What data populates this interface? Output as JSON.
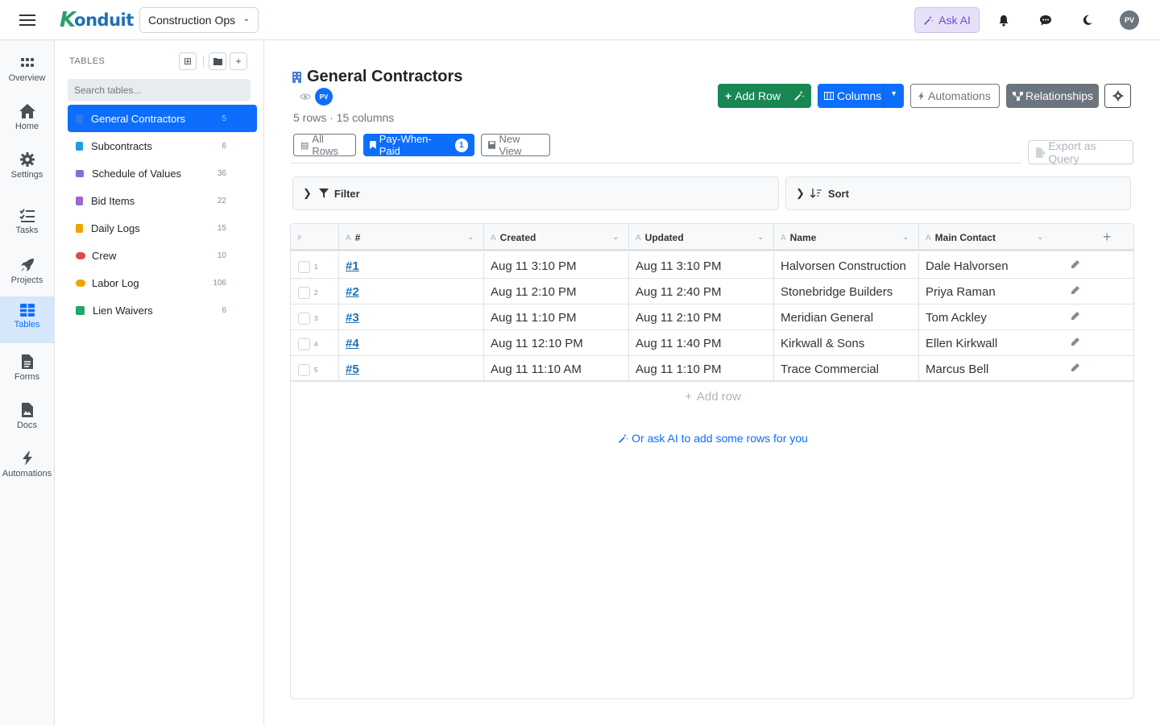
{
  "app": {
    "brand_k": "K",
    "brand_rest": "onduit",
    "workspace": "Construction Ops",
    "ask_ai": "Ask AI",
    "user_initials": "PV"
  },
  "rail": [
    {
      "label": "Overview",
      "icon": "grid-dots-icon"
    },
    {
      "label": "Home",
      "icon": "home-icon"
    },
    {
      "label": "Settings",
      "icon": "gear-icon"
    },
    {
      "label": "Tasks",
      "icon": "tasks-icon"
    },
    {
      "label": "Projects",
      "icon": "rocket-icon"
    },
    {
      "label": "Tables",
      "icon": "table-icon"
    },
    {
      "label": "Forms",
      "icon": "form-icon"
    },
    {
      "label": "Docs",
      "icon": "doc-icon"
    },
    {
      "label": "Automations",
      "icon": "bolt-icon"
    }
  ],
  "tables_panel": {
    "label": "TABLES",
    "search_placeholder": "Search tables...",
    "items": [
      {
        "name": "General Contractors",
        "count": "5",
        "color": "#4a7fd8"
      },
      {
        "name": "Subcontracts",
        "count": "6",
        "color": "#1a9fe0"
      },
      {
        "name": "Schedule of Values",
        "count": "36",
        "color": "#8a6cd6"
      },
      {
        "name": "Bid Items",
        "count": "22",
        "color": "#a066d4"
      },
      {
        "name": "Daily Logs",
        "count": "15",
        "color": "#f0a400"
      },
      {
        "name": "Crew",
        "count": "10",
        "color": "#e04848"
      },
      {
        "name": "Labor Log",
        "count": "106",
        "color": "#f0a400"
      },
      {
        "name": "Lien Waivers",
        "count": "6",
        "color": "#1fa86a"
      }
    ]
  },
  "page": {
    "title": "General Contractors",
    "owner_initials": "PV",
    "subtitle": "5 rows · 15 columns",
    "buttons": {
      "add_row": "Add Row",
      "columns": "Columns",
      "automations": "Automations",
      "relationships": "Relationships",
      "export": "Export as Query"
    },
    "views": [
      {
        "label": "All Rows"
      },
      {
        "label": "Pay-When-Paid",
        "badge": "1"
      },
      {
        "label": "New View"
      }
    ],
    "filter_label": "Filter",
    "sort_label": "Sort"
  },
  "grid": {
    "row_num_header": "#",
    "columns": [
      {
        "type": "A",
        "label": "#"
      },
      {
        "type": "A",
        "label": "Created"
      },
      {
        "type": "A",
        "label": "Updated"
      },
      {
        "type": "A",
        "label": "Name"
      },
      {
        "type": "A",
        "label": "Main Contact"
      }
    ],
    "rows": [
      {
        "n": "1",
        "id": "#1",
        "created": "Aug 11 3:10 PM",
        "updated": "Aug 11 3:10 PM",
        "name": "Halvorsen Construction",
        "contact": "Dale Halvorsen"
      },
      {
        "n": "2",
        "id": "#2",
        "created": "Aug 11 2:10 PM",
        "updated": "Aug 11 2:40 PM",
        "name": "Stonebridge Builders",
        "contact": "Priya Raman"
      },
      {
        "n": "3",
        "id": "#3",
        "created": "Aug 11 1:10 PM",
        "updated": "Aug 11 2:10 PM",
        "name": "Meridian General",
        "contact": "Tom Ackley"
      },
      {
        "n": "4",
        "id": "#4",
        "created": "Aug 11 12:10 PM",
        "updated": "Aug 11 1:40 PM",
        "name": "Kirkwall & Sons",
        "contact": "Ellen Kirkwall"
      },
      {
        "n": "5",
        "id": "#5",
        "created": "Aug 11 11:10 AM",
        "updated": "Aug 11 1:10 PM",
        "name": "Trace Commercial",
        "contact": "Marcus Bell"
      }
    ],
    "add_row": "Add row",
    "ask_ai_rows": "Or ask AI to add some rows for you"
  }
}
